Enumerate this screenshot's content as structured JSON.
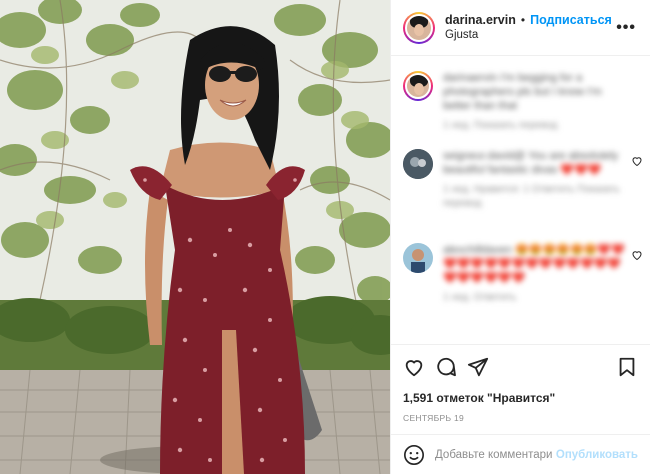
{
  "header": {
    "username": "darina.ervin",
    "separator": "•",
    "follow_label": "Подписаться",
    "location": "Gjusta",
    "more_icon": "more-horizontal-icon"
  },
  "comments": [
    {
      "text": "darinaervin I'm begging for a photographers pls but I know I'm better than that",
      "meta": "1 нед.   Показать перевод"
    },
    {
      "text": "seigneur.david@ You are absolutely beautiful fantastic divas ❤️❤️❤️",
      "meta": "1 нед.   Нравится: 1   Ответить   Показать перевод"
    },
    {
      "text": "alexchilldaven 😍😍😍😍😍😍❤️❤️❤️❤️❤️❤️❤️❤️❤️❤️❤️❤️❤️❤️❤️❤️❤️❤️❤️❤️❤️",
      "meta": "1 нед.   Ответить"
    }
  ],
  "actions": {
    "like_icon": "heart-icon",
    "comment_icon": "comment-icon",
    "share_icon": "paper-plane-icon",
    "save_icon": "bookmark-icon",
    "likes_text": "1,591 отметок \"Нравится\"",
    "date_text": "Сентябрь 19"
  },
  "add_comment": {
    "emoji_icon": "smiley-icon",
    "placeholder": "Добавьте комментарий...",
    "publish_label": "Опубликовать"
  },
  "colors": {
    "accent": "#0095f6",
    "publish_disabled": "#b2dffc",
    "dress": "#7d1f2a",
    "text": "#262626",
    "muted": "#8e8e8e"
  }
}
